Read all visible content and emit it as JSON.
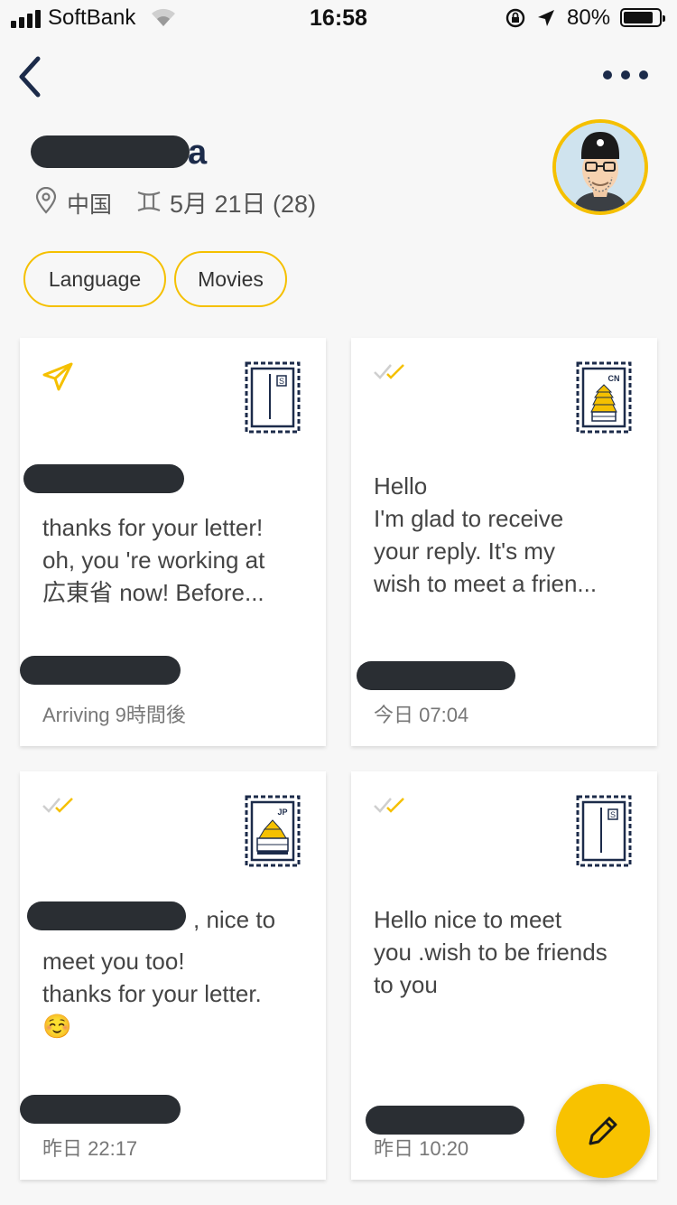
{
  "status_bar": {
    "carrier": "SoftBank",
    "time": "16:58",
    "battery": "80%",
    "battery_level": 0.8
  },
  "profile": {
    "name_suffix": "a",
    "location": "中国",
    "birthday": "5月 21日 (28)",
    "interests": [
      "Language",
      "Movies"
    ]
  },
  "letters": [
    {
      "status": "sent",
      "stamp": "plain-stamp",
      "stamp_label": "S",
      "body": "thanks for your letter!\noh, you 're working at\n広東省 now! Before...",
      "time": "Arriving 9時間後"
    },
    {
      "status": "read",
      "stamp": "castle-stamp",
      "stamp_label": "CN",
      "body": "Hello\nI'm glad to receive\nyour reply. It's my\nwish to meet a frien...",
      "time": "今日 07:04"
    },
    {
      "status": "read",
      "stamp": "castle-stamp",
      "stamp_label": "JP",
      "body_first": ", nice to",
      "body": "meet you too!\nthanks for your letter.\n☺️",
      "time": "昨日 22:17"
    },
    {
      "status": "read",
      "stamp": "plain-stamp",
      "stamp_label": "S",
      "body": "Hello nice to meet\nyou .wish to be friends\nto you",
      "time": "昨日 10:20"
    }
  ],
  "colors": {
    "accent": "#f5c000",
    "navy": "#1c2b4a",
    "redaction": "#2a2e33"
  }
}
